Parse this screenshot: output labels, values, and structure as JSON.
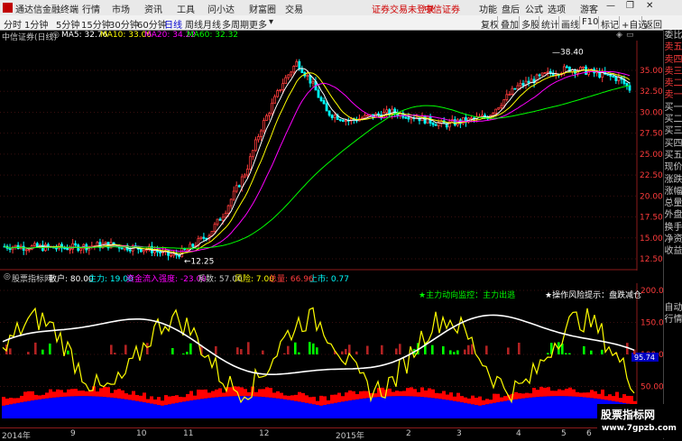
{
  "app": {
    "logo_icon": "app-logo-icon",
    "title": "通达信金融终端"
  },
  "menu": [
    "行情",
    "市场",
    "资讯",
    "工具",
    "问小达",
    "财富圈",
    "交易"
  ],
  "status": {
    "login": "证券交易未登录",
    "broker": "中信证券"
  },
  "topright": [
    "功能",
    "盘后",
    "公式",
    "选项",
    "游客"
  ],
  "periods": [
    "分时",
    "1分钟",
    "5分钟",
    "15分钟",
    "30分钟",
    "60分钟",
    "日线",
    "周线",
    "月线",
    "多周期",
    "更多"
  ],
  "selected_period": "日线",
  "tools": [
    "复权",
    "叠加",
    "多股",
    "统计",
    "画线",
    "F10",
    "标记",
    "+自选",
    "返回"
  ],
  "stock_title": "中信证券(日线)",
  "ma": [
    {
      "label": "MA5: 32.76",
      "color": "#ffffff"
    },
    {
      "label": "MA10: 33.06",
      "color": "#ffff00"
    },
    {
      "label": "MA20: 34.22",
      "color": "#ff00ff"
    },
    {
      "label": "MA60: 32.32",
      "color": "#00ff00"
    }
  ],
  "price_axis": [
    "35.00",
    "32.50",
    "30.00",
    "27.50",
    "25.00",
    "22.50",
    "20.00",
    "17.50",
    "15.00",
    "12.50"
  ],
  "price_marks": {
    "high": "38.40",
    "low": "12.25"
  },
  "indicator": {
    "name": "股票指标网",
    "sanhu": "散户: 80.00",
    "zhuli": "主力: 19.00",
    "inflow": "资金流入强度: -23.00",
    "coef": "系数: 57.00",
    "risk": "风险: 7.00",
    "total": "总量: 66.96",
    "up": "上市: 0.77",
    "monitor": "★主力动向监控：主力出逃",
    "tip": "★操作风险提示：盘跌减仓"
  },
  "ind_axis": [
    "200.0",
    "150.0",
    "100.0",
    "50.00"
  ],
  "ind_current": "95.74",
  "date_axis": [
    "2014年",
    "9",
    "10",
    "11",
    "12",
    "2015年",
    "2",
    "3",
    "4",
    "5",
    "6"
  ],
  "right_panel": [
    "委比",
    "卖五",
    "卖四",
    "卖三",
    "卖二",
    "卖一",
    "买一",
    "买二",
    "买三",
    "买四",
    "买五",
    "现价",
    "涨跌",
    "涨幅",
    "总量",
    "外盘",
    "换手",
    "净资",
    "收益"
  ],
  "right_bottom": [
    "自动",
    "行情"
  ],
  "watermark": {
    "line1": "股票指标网",
    "line2": "www.7gpzb.com"
  },
  "colors": {
    "up": "#ff3c3c",
    "down": "#00ffff",
    "ma5": "#ffffff",
    "ma10": "#ffff00",
    "ma20": "#ff00ff",
    "ma60": "#00ff00",
    "bar_green": "#00ff00",
    "bar_red": "#ff0000",
    "bar_blue": "#0000ff"
  }
}
